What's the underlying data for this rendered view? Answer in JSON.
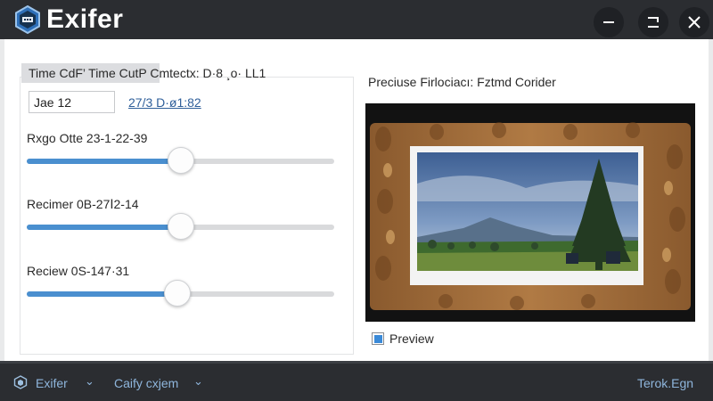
{
  "window": {
    "title": "Exifer",
    "controls": {
      "minimize": "minimize-icon",
      "maximize": "restore-icon",
      "close": "close-icon"
    }
  },
  "left_panel": {
    "header": "Time CdF’ Time CutP Cmtectx: D·8 ¸o· LL1",
    "input_value": "Jae 12",
    "date_link": "27/3 D·ø1:82",
    "sliders": [
      {
        "label": "Rxgo Otte 23-1-22-39",
        "value_pct": 50
      },
      {
        "label": "Recimer 0B-27Ⅰ2-14",
        "value_pct": 50
      },
      {
        "label": "Reciew 0S-147·31",
        "value_pct": 49
      }
    ]
  },
  "preview": {
    "title": "Preciuse Firlociacı: Fztmd Corider",
    "checkbox_label": "Preview",
    "checked": true
  },
  "statusbar": {
    "app_label": "Exifer",
    "menu_label": "Caify cxjem",
    "right_label": "Terok.Egn"
  },
  "colors": {
    "accent": "#4a8fcf",
    "titlebar": "#2b2d31",
    "link": "#2f5f9a"
  }
}
